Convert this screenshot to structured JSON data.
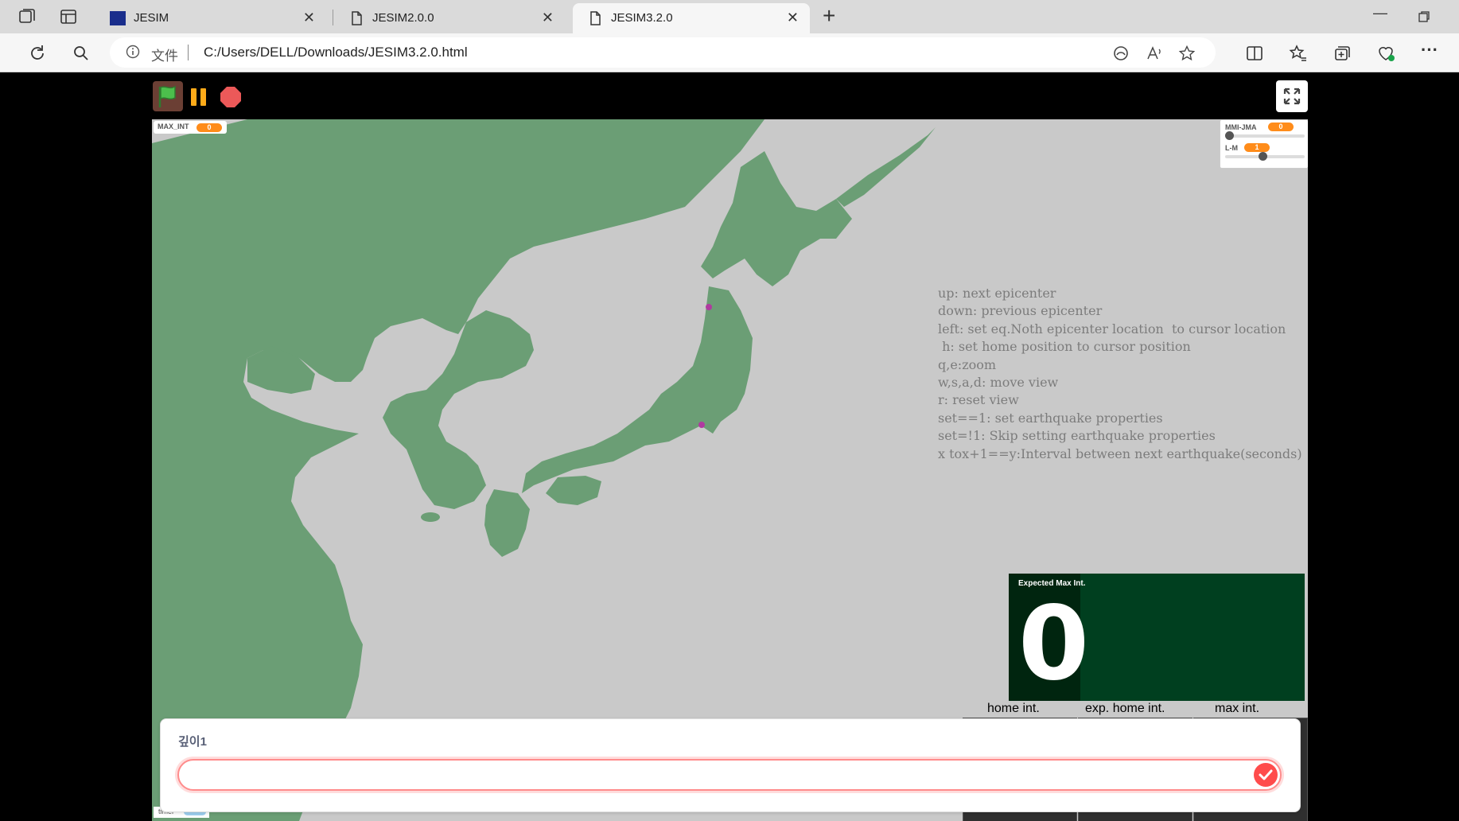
{
  "browser": {
    "tabs": [
      {
        "title": "JESIM",
        "favicon": "eu-flag-icon"
      },
      {
        "title": "JESIM2.0.0",
        "favicon": "file-icon"
      },
      {
        "title": "JESIM3.2.0",
        "favicon": "file-icon",
        "active": true
      }
    ],
    "address": {
      "scheme_label": "文件",
      "url": "C:/Users/DELL/Downloads/JESIM3.2.0.html"
    }
  },
  "stage": {
    "max_int": {
      "label": "MAX_INT",
      "value": "0"
    },
    "sliders": [
      {
        "label": "MMI-JMA",
        "value": "0",
        "level": 0
      },
      {
        "label": "L-M",
        "value": "1",
        "level": 0.47
      }
    ],
    "help_lines": [
      "up: next epicenter",
      "down: previous epicenter",
      "left: set eq.Noth epicenter location  to cursor location",
      " h: set home position to cursor position",
      "q,e:zoom",
      "w,s,a,d: move view",
      "r: reset view",
      "set==1: set earthquake properties",
      "set=!1: Skip setting earthquake properties",
      "x tox+1==y:Interval between next earthquake(seconds)"
    ],
    "expected": {
      "label": "Expected Max Int.",
      "value": "0"
    },
    "int_labels": {
      "home": "home int.",
      "exp_home": "exp. home int.",
      "max": "max int."
    },
    "timer": {
      "label": "timer"
    }
  },
  "ask": {
    "question": "깊이1",
    "answer_value": "",
    "colors": {
      "border": "#ff8c8c",
      "submit": "#ff4c4c"
    }
  },
  "colors": {
    "land": "#6b9e75",
    "sea": "#c9c9c9",
    "expected_panel": "#003f1f",
    "pill": "#ff8c1a"
  }
}
